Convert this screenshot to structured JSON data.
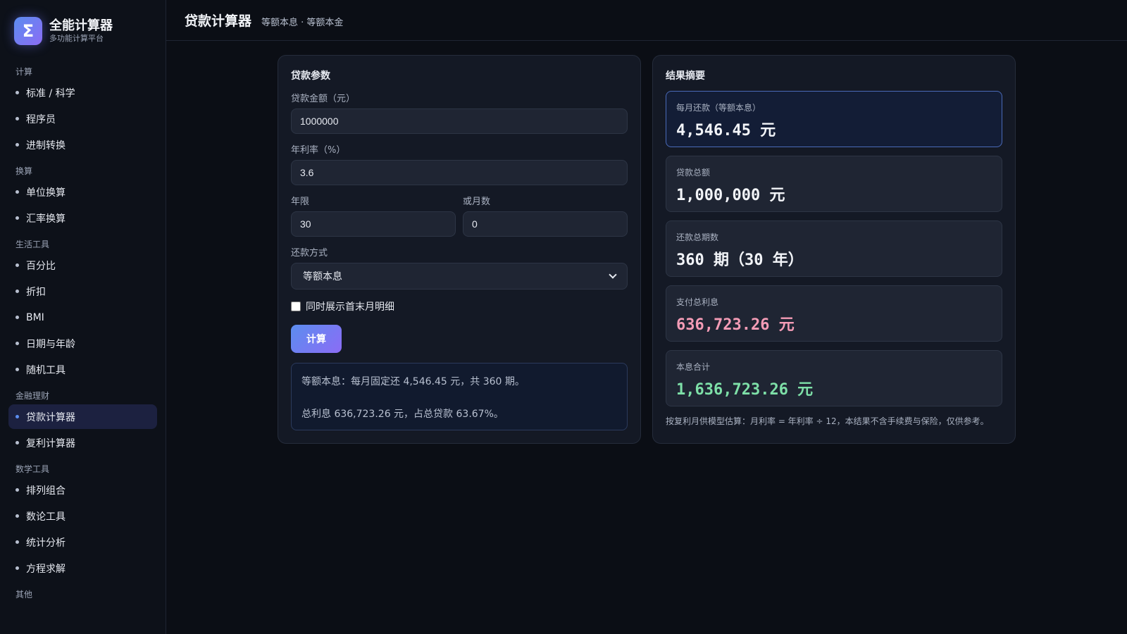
{
  "brand": {
    "logo": "Σ",
    "title": "全能计算器",
    "subtitle": "多功能计算平台"
  },
  "sidebar": {
    "groups": [
      {
        "label": "计算",
        "items": [
          "标准 / 科学",
          "程序员",
          "进制转换"
        ]
      },
      {
        "label": "换算",
        "items": [
          "单位换算",
          "汇率换算"
        ]
      },
      {
        "label": "生活工具",
        "items": [
          "百分比",
          "折扣",
          "BMI",
          "日期与年龄",
          "随机工具"
        ]
      },
      {
        "label": "金融理财",
        "items": [
          "贷款计算器",
          "复利计算器"
        ]
      },
      {
        "label": "数学工具",
        "items": [
          "排列组合",
          "数论工具",
          "统计分析",
          "方程求解"
        ]
      },
      {
        "label": "其他",
        "items": []
      }
    ],
    "active": "贷款计算器"
  },
  "header": {
    "title": "贷款计算器",
    "subtitle": "等额本息 · 等额本金"
  },
  "params": {
    "title": "贷款参数",
    "amount_label": "贷款金额（元）",
    "amount_value": "1000000",
    "rate_label": "年利率（%）",
    "rate_value": "3.6",
    "years_label": "年限",
    "years_value": "30",
    "months_label": "或月数",
    "months_value": "0",
    "method_label": "还款方式",
    "method_value": "等额本息",
    "checkbox_label": "同时展示首末月明细",
    "checkbox_checked": false,
    "calc_label": "计算",
    "summary_line1": "等额本息：每月固定还 4,546.45 元，共 360 期。",
    "summary_line2": "总利息 636,723.26 元，占总贷款 63.67%。"
  },
  "results": {
    "title": "结果摘要",
    "cards": [
      {
        "label": "每月还款（等额本息）",
        "value": "4,546.45 元"
      },
      {
        "label": "贷款总额",
        "value": "1,000,000 元"
      },
      {
        "label": "还款总期数",
        "value": "360 期（30 年）"
      },
      {
        "label": "支付总利息",
        "value": "636,723.26 元"
      },
      {
        "label": "本息合计",
        "value": "1,636,723.26 元"
      }
    ],
    "footnote": "按复利月供模型估算：月利率 = 年利率 ÷ 12，本结果不含手续费与保险，仅供参考。"
  },
  "colors": {
    "accent": "#5b8def",
    "interest": "#f49cb6",
    "total": "#7ee0a8"
  }
}
